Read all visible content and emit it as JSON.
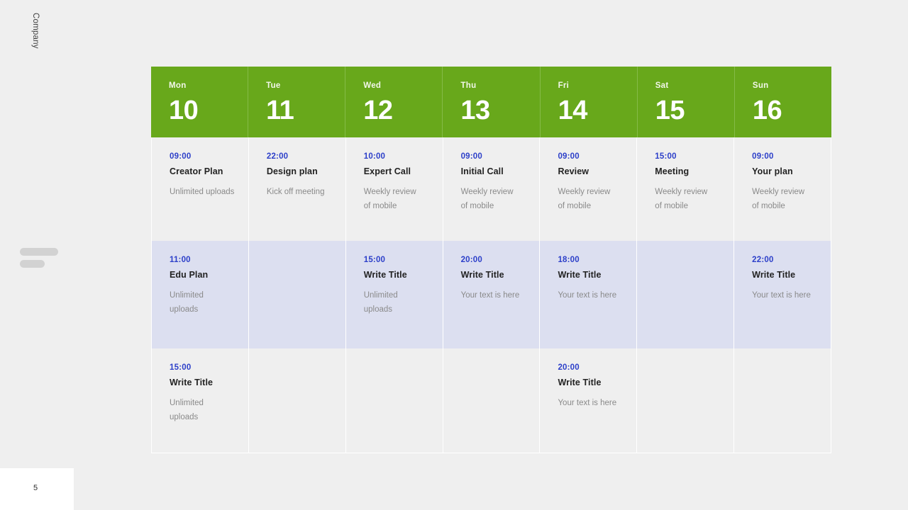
{
  "brand": {
    "company_label": "Company",
    "logo_icon": "two-bars-placeholder-icon"
  },
  "footer": {
    "page_number": "5"
  },
  "colors": {
    "header_green": "#68a81b",
    "header_green_divider": "#85bb48",
    "row_light": "#efefef",
    "row_lavender": "#dcdff0",
    "time_blue": "#2c3fc9",
    "title_dark": "#222222",
    "desc_gray": "#8a8a8a",
    "canvas": "#efefef",
    "grid_line": "#ffffff"
  },
  "calendar": {
    "columns": [
      {
        "dow": "Mon",
        "date": "10"
      },
      {
        "dow": "Tue",
        "date": "11"
      },
      {
        "dow": "Wed",
        "date": "12"
      },
      {
        "dow": "Thu",
        "date": "13"
      },
      {
        "dow": "Fri",
        "date": "14"
      },
      {
        "dow": "Sat",
        "date": "15"
      },
      {
        "dow": "Sun",
        "date": "16"
      }
    ],
    "rows": [
      {
        "tone": "light",
        "cells": [
          {
            "time": "09:00",
            "title": "Creator Plan",
            "desc": "Unlimited  uploads",
            "wide": true
          },
          {
            "time": "22:00",
            "title": "Design plan",
            "desc": "Kick off meeting"
          },
          {
            "time": "10:00",
            "title": "Expert Call",
            "desc": "Weekly review of mobile"
          },
          {
            "time": "09:00",
            "title": "Initial Call",
            "desc": "Weekly review of mobile"
          },
          {
            "time": "09:00",
            "title": "Review",
            "desc": "Weekly review of mobile"
          },
          {
            "time": "15:00",
            "title": "Meeting",
            "desc": "Weekly review of mobile"
          },
          {
            "time": "09:00",
            "title": "Your plan",
            "desc": "Weekly review of mobile"
          }
        ]
      },
      {
        "tone": "lavender",
        "cells": [
          {
            "time": "11:00",
            "title": "Edu Plan",
            "desc": "Unlimited uploads"
          },
          {
            "time": "",
            "title": "",
            "desc": ""
          },
          {
            "time": "15:00",
            "title": "Write Title",
            "desc": "Unlimited uploads"
          },
          {
            "time": "20:00",
            "title": "Write Title",
            "desc": "Your text is here"
          },
          {
            "time": "18:00",
            "title": "Write Title",
            "desc": "Your text is here"
          },
          {
            "time": "",
            "title": "",
            "desc": ""
          },
          {
            "time": "22:00",
            "title": "Write Title",
            "desc": "Your text is here"
          }
        ]
      },
      {
        "tone": "light",
        "cells": [
          {
            "time": "15:00",
            "title": "Write Title",
            "desc": "Unlimited uploads"
          },
          {
            "time": "",
            "title": "",
            "desc": ""
          },
          {
            "time": "",
            "title": "",
            "desc": ""
          },
          {
            "time": "",
            "title": "",
            "desc": ""
          },
          {
            "time": "20:00",
            "title": "Write Title",
            "desc": "Your text is here"
          },
          {
            "time": "",
            "title": "",
            "desc": ""
          },
          {
            "time": "",
            "title": "",
            "desc": ""
          }
        ]
      }
    ]
  }
}
